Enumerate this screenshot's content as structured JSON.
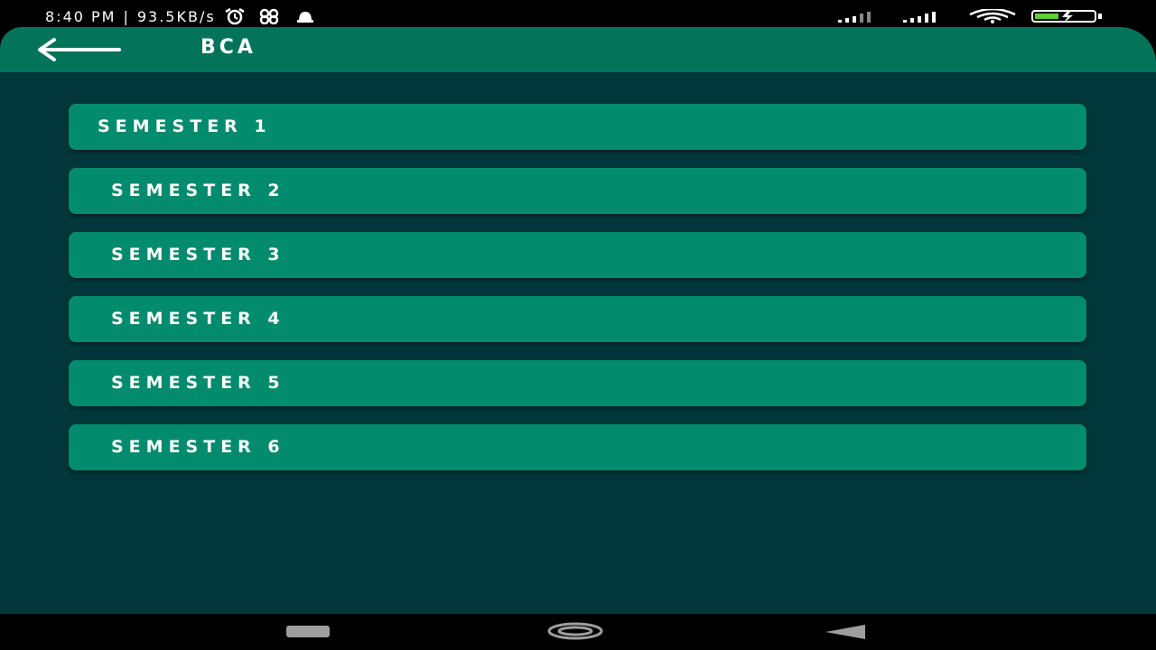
{
  "status_bar": {
    "time": "8:40 PM",
    "separator": "|",
    "network_speed": "93.5KB/s"
  },
  "app_bar": {
    "title": "BCA",
    "back_icon": "arrow-left-icon"
  },
  "semesters": [
    {
      "label": "SEMESTER 1"
    },
    {
      "label": "SEMESTER 2"
    },
    {
      "label": "SEMESTER 3"
    },
    {
      "label": "SEMESTER 4"
    },
    {
      "label": "SEMESTER 5"
    },
    {
      "label": "SEMESTER 6"
    }
  ],
  "colors": {
    "app_bar": "#03745a",
    "background": "#01373a",
    "item": "#038b6d",
    "text": "#ffffff"
  },
  "nav_bar": {
    "icons": [
      "recents-icon",
      "home-icon",
      "back-triangle-icon"
    ]
  }
}
